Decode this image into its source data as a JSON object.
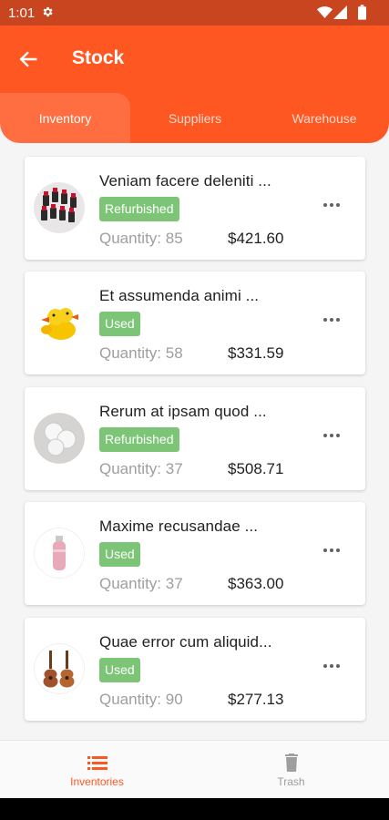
{
  "status_bar": {
    "time": "1:01"
  },
  "app_bar": {
    "title": "Stock"
  },
  "tabs": [
    {
      "label": "Inventory",
      "active": true
    },
    {
      "label": "Suppliers",
      "active": false
    },
    {
      "label": "Warehouse",
      "active": false
    }
  ],
  "items": [
    {
      "name": "Veniam facere deleniti ...",
      "condition": "Refurbished",
      "quantity": "Quantity: 85",
      "price": "$421.60",
      "image": "lipsticks"
    },
    {
      "name": "Et assumenda animi ...",
      "condition": "Used",
      "quantity": "Quantity: 58",
      "price": "$331.59",
      "image": "rubber-ducks"
    },
    {
      "name": "Rerum at ipsam quod ...",
      "condition": "Refurbished",
      "quantity": "Quantity: 37",
      "price": "$508.71",
      "image": "cotton-pads"
    },
    {
      "name": "Maxime recusandae ...",
      "condition": "Used",
      "quantity": "Quantity: 37",
      "price": "$363.00",
      "image": "water-bottle"
    },
    {
      "name": "Quae error cum aliquid...",
      "condition": "Used",
      "quantity": "Quantity: 90",
      "price": "$277.13",
      "image": "ukuleles"
    }
  ],
  "bottom_nav": [
    {
      "label": "Inventories",
      "icon": "list-icon",
      "active": true
    },
    {
      "label": "Trash",
      "icon": "trash-icon",
      "active": false
    }
  ],
  "colors": {
    "primary": "#ff5722",
    "status_bar": "#c8451f",
    "badge": "#7cc576",
    "inactive_nav": "#9e9e9e"
  }
}
